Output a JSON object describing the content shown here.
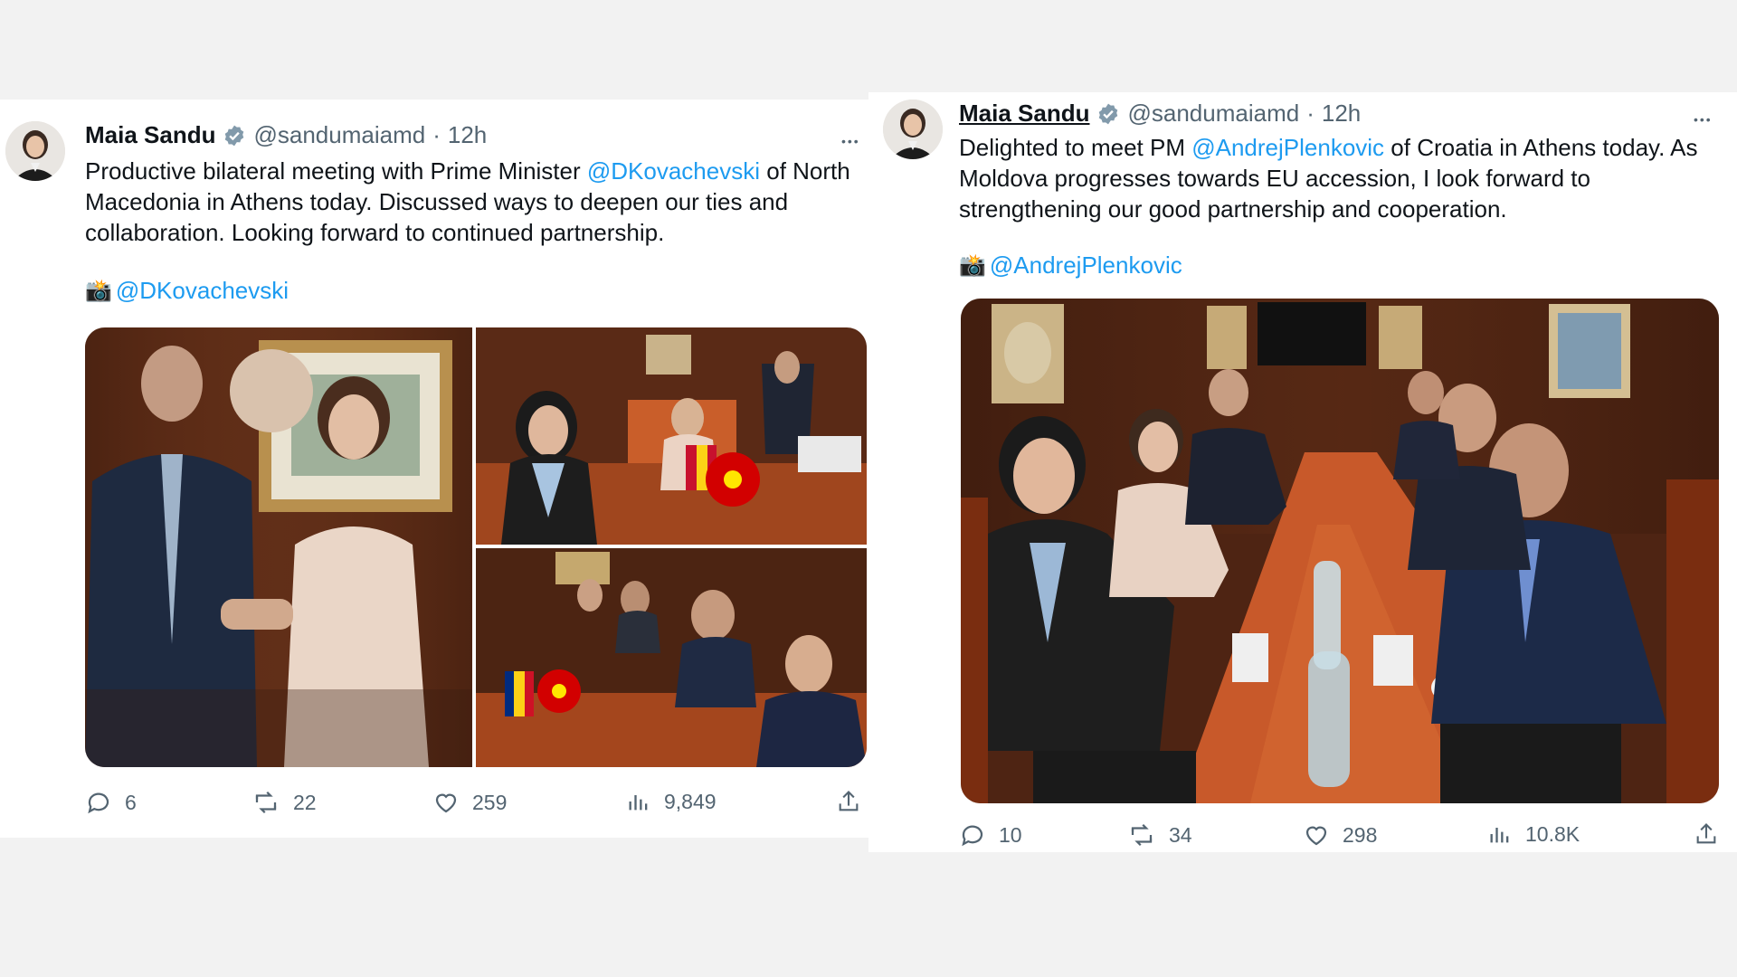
{
  "tweets": [
    {
      "author_name": "Maia Sandu",
      "handle": "@sandumaiamd",
      "separator": "·",
      "time": "12h",
      "more": "•••",
      "text_parts": {
        "before": "Productive bilateral meeting with Prime Minister ",
        "mention": "@DKovachevski",
        "after": " of North Macedonia in Athens today. Discussed ways to deepen our ties and collaboration. Looking forward to continued partnership."
      },
      "photo_credit_icon": "📸",
      "photo_credit": "@DKovachevski",
      "stats": {
        "replies": "6",
        "reposts": "22",
        "likes": "259",
        "views": "9,849"
      }
    },
    {
      "author_name": "Maia Sandu",
      "handle": "@sandumaiamd",
      "separator": "·",
      "time": "12h",
      "more": "•••",
      "text_parts": {
        "before": "Delighted to meet PM ",
        "mention": "@AndrejPlenkovic",
        "after": " of Croatia in Athens today. As Moldova progresses towards EU accession, I look forward to strengthening our good partnership and cooperation."
      },
      "photo_credit_icon": "📸",
      "photo_credit": "@AndrejPlenkovic",
      "stats": {
        "replies": "10",
        "reposts": "34",
        "likes": "298",
        "views": "10.8K"
      }
    }
  ],
  "icons": {
    "verified": "verified-badge-icon",
    "reply": "reply-icon",
    "repost": "repost-icon",
    "like": "heart-icon",
    "views": "views-chart-icon",
    "share": "share-icon",
    "more": "more-options-icon"
  },
  "colors": {
    "link": "#1d9bf0",
    "muted": "#536471",
    "text": "#0f1419",
    "background": "#f2f2f2"
  }
}
